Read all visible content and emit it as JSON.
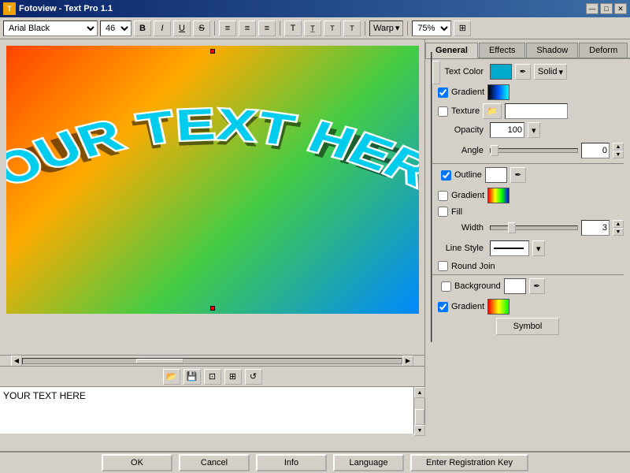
{
  "window": {
    "title": "Fotoview - Text Pro 1.1"
  },
  "titlebar": {
    "minimize_label": "—",
    "maximize_label": "□",
    "close_label": "✕"
  },
  "toolbar": {
    "font_name": "Arial Black",
    "font_size": "46",
    "bold_label": "B",
    "italic_label": "I",
    "underline_label": "U",
    "strikethrough_label": "S",
    "align_left_label": "≡",
    "align_center_label": "≡",
    "align_right_label": "≡",
    "warp_label": "Warp",
    "zoom_value": "75%",
    "zoom_icon_label": "⊞"
  },
  "tabs": {
    "items": [
      "General",
      "Effects",
      "Shadow",
      "Deform"
    ],
    "active": "General"
  },
  "canvas": {
    "text_content": "YOUR TEXT HERE"
  },
  "panel": {
    "text_color_label": "Text Color",
    "gradient_label": "Gradient",
    "texture_label": "Texture",
    "opacity_label": "Opacity",
    "opacity_value": "100",
    "angle_label": "Angle",
    "angle_value": "0",
    "outline_label": "Outline",
    "outline_gradient_label": "Gradient",
    "fill_label": "Fill",
    "width_label": "Width",
    "width_value": "3",
    "line_style_label": "Line Style",
    "round_join_label": "Round Join",
    "background_label": "Background",
    "gradient2_label": "Gradient",
    "symbol_btn_label": "Symbol",
    "solid_label": "Solid",
    "gradient_checked": true,
    "texture_checked": false,
    "outline_checked": true,
    "outline_gradient_checked": false,
    "fill_checked": false,
    "round_join_checked": false,
    "background_checked": false,
    "gradient2_checked": true
  },
  "bottom_buttons": {
    "ok_label": "OK",
    "cancel_label": "Cancel",
    "info_label": "Info",
    "language_label": "Language",
    "register_label": "Enter Registration Key"
  },
  "icons": {
    "eyedropper": "✒",
    "folder": "📁",
    "up_arrow": "▲",
    "down_arrow": "▼",
    "left_arrow": "◀",
    "right_arrow": "▶",
    "chevron_down": "▾",
    "bold_text": "B",
    "italic_text": "I",
    "underline_text": "U",
    "strikethrough_text": "S̶",
    "fit_icon": "⊡",
    "zoom_box": "⊞"
  }
}
